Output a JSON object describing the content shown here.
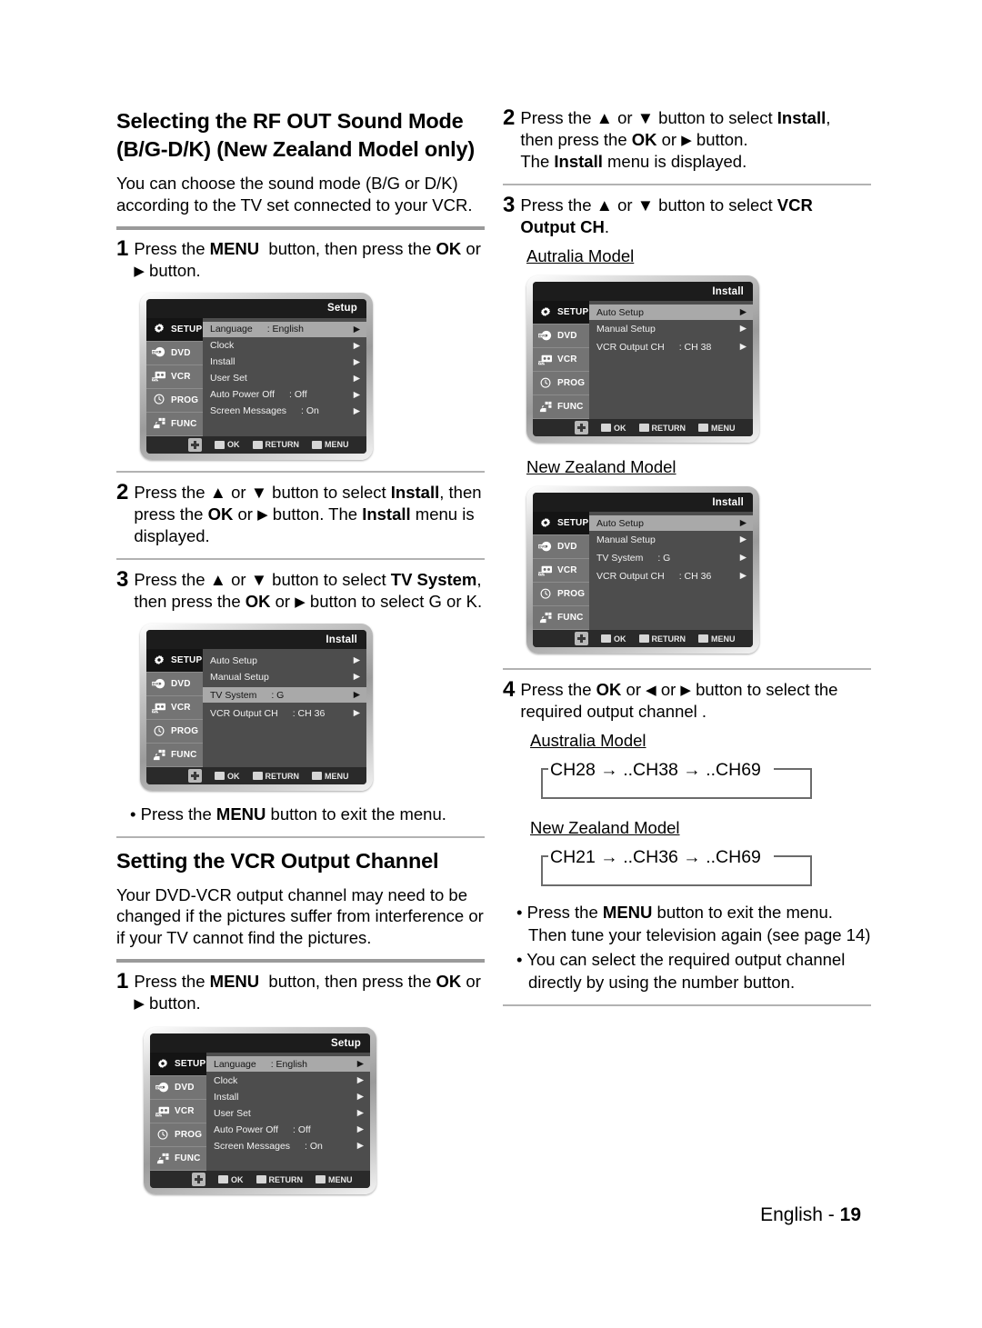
{
  "footer": {
    "label": "English -",
    "page": "19"
  },
  "left_column": {
    "section1": {
      "title_line1": "Selecting the RF OUT Sound Mode",
      "title_line2": "(B/G-D/K) (New Zealand Model only)",
      "intro": "You can choose the sound mode (B/G or D/K) according to the TV set connected to your VCR.",
      "step1": {
        "num": "1",
        "text_parts": [
          "Press the ",
          "MENU",
          "  button, then press the ",
          "OK",
          " or ",
          "▶",
          " button."
        ]
      },
      "step2": {
        "num": "2",
        "text_parts": [
          "Press the ",
          "▲",
          " or ",
          "▼",
          " button to select ",
          "Install",
          ", then press the ",
          "OK",
          " or ",
          "▶",
          " button. The ",
          "Install",
          " menu is displayed."
        ]
      },
      "step3": {
        "num": "3",
        "text_parts": [
          "Press the ",
          "▲",
          " or ",
          "▼",
          " button to select ",
          "TV System",
          ", then press the ",
          "OK",
          " or ",
          "▶",
          " button to select G or K."
        ]
      },
      "note": "• Press the MENU button to exit the menu."
    },
    "section2": {
      "title": "Setting the VCR Output Channel",
      "intro": "Your DVD-VCR output channel may need to be changed if the pictures suffer from interference or if your TV cannot find the pictures.",
      "step1": {
        "num": "1",
        "text_parts": [
          "Press the ",
          "MENU",
          "  button, then press the ",
          "OK",
          " or ",
          "▶",
          " button."
        ]
      }
    }
  },
  "right_column": {
    "step2": {
      "num": "2",
      "line1_parts": [
        "Press the ",
        "▲",
        " or ",
        "▼",
        " button to select ",
        "Install",
        ","
      ],
      "line2_parts": [
        "then press the ",
        "OK",
        " or ",
        "▶",
        " button."
      ],
      "line3_parts": [
        "The ",
        "Install",
        " menu is displayed."
      ]
    },
    "step3": {
      "num": "3",
      "line1_parts": [
        "Press the ",
        "▲",
        " or ",
        "▼",
        " button to select ",
        "VCR"
      ],
      "line2_bold": "Output CH",
      "model_label_au": "Autralia Model ",
      "model_label_nz": "New Zealand Model"
    },
    "step4": {
      "num": "4",
      "text_parts": [
        "Press the ",
        "OK",
        " or ",
        "◀",
        " or ",
        "▶",
        " button to select the required output channel ."
      ],
      "model_label_au": "Australia Model",
      "model_label_nz": "New Zealand Model",
      "range_au": "CH28 → ..CH38  → ..CH69",
      "range_nz": "CH21 → ..CH36  → ..CH69"
    },
    "notes": [
      "• Press the MENU button to exit the menu. Then tune your television again (see page 14)",
      "• You can select the required output channel directly by using the number button."
    ]
  },
  "osd_common": {
    "sidebar": [
      {
        "label": "SETUP",
        "icon": "gear-icon"
      },
      {
        "label": "DVD",
        "icon": "dvd-disc-icon"
      },
      {
        "label": "VCR",
        "icon": "vcr-cassette-icon"
      },
      {
        "label": "PROG",
        "icon": "clock-icon"
      },
      {
        "label": "FUNC",
        "icon": "function-hand-icon"
      }
    ],
    "footer_buttons": [
      {
        "label": "OK",
        "icon": "enter-key-icon"
      },
      {
        "label": "RETURN",
        "icon": "return-arrow-icon"
      },
      {
        "label": "MENU",
        "icon": "menu-key-icon"
      }
    ],
    "nav_icon": "dpad-icon",
    "arrow": "▶"
  },
  "osd_screens": {
    "setup_menu_1": {
      "title": "Setup",
      "rows": [
        {
          "label": "Language",
          "value": ": English",
          "selected": true
        },
        {
          "label": "Clock",
          "value": "",
          "selected": false
        },
        {
          "label": "Install",
          "value": "",
          "selected": false
        },
        {
          "label": "User Set",
          "value": "",
          "selected": false
        },
        {
          "label": "Auto Power Off",
          "value": ": Off",
          "selected": false
        },
        {
          "label": "Screen Messages",
          "value": ": On",
          "selected": false
        }
      ]
    },
    "install_menu_nz_tvsystem": {
      "title": "Install",
      "rows": [
        {
          "label": "Auto Setup",
          "value": "",
          "selected": false
        },
        {
          "label": "Manual Setup",
          "value": "",
          "selected": false
        },
        {
          "label": "TV System",
          "value": ": G",
          "selected": true
        },
        {
          "label": "VCR Output  CH",
          "value": ": CH 36",
          "selected": false
        }
      ]
    },
    "setup_menu_2": {
      "title": "Setup",
      "rows": [
        {
          "label": "Language",
          "value": ": English",
          "selected": true
        },
        {
          "label": "Clock",
          "value": "",
          "selected": false
        },
        {
          "label": "Install",
          "value": "",
          "selected": false
        },
        {
          "label": "User Set",
          "value": "",
          "selected": false
        },
        {
          "label": "Auto Power Off",
          "value": ": Off",
          "selected": false
        },
        {
          "label": "Screen Messages",
          "value": ": On",
          "selected": false
        }
      ]
    },
    "install_menu_australia": {
      "title": "Install",
      "rows": [
        {
          "label": "Auto Setup",
          "value": "",
          "selected": true
        },
        {
          "label": "Manual Setup",
          "value": "",
          "selected": false
        },
        {
          "label": "VCR Output  CH",
          "value": ": CH 38",
          "selected": false
        }
      ]
    },
    "install_menu_newzealand": {
      "title": "Install",
      "rows": [
        {
          "label": "Auto Setup",
          "value": "",
          "selected": true
        },
        {
          "label": "Manual Setup",
          "value": "",
          "selected": false
        },
        {
          "label": "TV System",
          "value": ": G",
          "selected": false
        },
        {
          "label": "VCR Output  CH",
          "value": ": CH 36",
          "selected": false
        }
      ]
    }
  }
}
